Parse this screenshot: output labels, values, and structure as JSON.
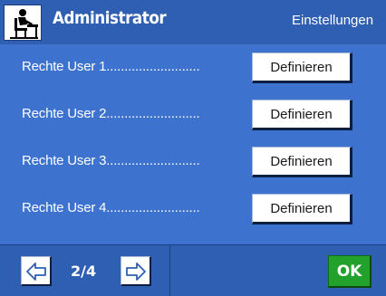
{
  "header": {
    "title": "Administrator",
    "section": "Einstellungen",
    "icon": "administrator-desk-icon"
  },
  "rows": [
    {
      "label": "Rechte User 1..........................",
      "button_label": "Definieren"
    },
    {
      "label": "Rechte User 2..........................",
      "button_label": "Definieren"
    },
    {
      "label": "Rechte User 3..........................",
      "button_label": "Definieren"
    },
    {
      "label": "Rechte User 4..........................",
      "button_label": "Definieren"
    }
  ],
  "footer": {
    "page_indicator": "2/4",
    "prev_icon": "arrow-left-icon",
    "next_icon": "arrow-right-icon",
    "ok_label": "OK"
  },
  "colors": {
    "header_bg": "#2f5fb3",
    "content_bg": "#3d72cf",
    "ok_green": "#22a12c"
  }
}
